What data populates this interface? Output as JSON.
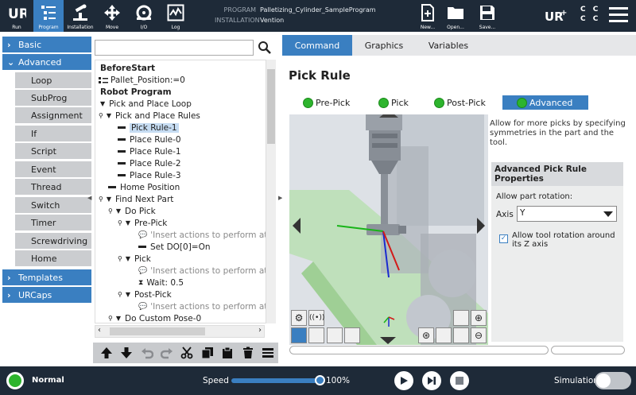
{
  "header": {
    "buttons": [
      {
        "label": "Run",
        "icon": "ur-logo-icon"
      },
      {
        "label": "Program",
        "icon": "program-icon"
      },
      {
        "label": "Installation",
        "icon": "installation-icon"
      },
      {
        "label": "Move",
        "icon": "move-icon"
      },
      {
        "label": "I/O",
        "icon": "io-icon"
      },
      {
        "label": "Log",
        "icon": "log-icon"
      }
    ],
    "program_key": "PROGRAM",
    "program_value": "Palletizing_Cylinder_SampleProgram",
    "installation_key": "INSTALLATION",
    "installation_value": "Vention",
    "file_buttons": [
      {
        "label": "New...",
        "icon": "new-file-icon"
      },
      {
        "label": "Open...",
        "icon": "open-folder-icon"
      },
      {
        "label": "Save...",
        "icon": "save-icon"
      }
    ],
    "cc_line1": "C C",
    "cc_line2": "C C"
  },
  "nav": {
    "groups": [
      {
        "label": "Basic"
      },
      {
        "label": "Advanced"
      },
      {
        "label": "Templates"
      },
      {
        "label": "URCaps"
      }
    ],
    "advanced_items": [
      "Loop",
      "SubProg",
      "Assignment",
      "If",
      "Script",
      "Event",
      "Thread",
      "Switch",
      "Timer",
      "Screwdriving",
      "Home"
    ]
  },
  "tree": {
    "rows": [
      "BeforeStart",
      "Pallet_Position:=0",
      "Robot Program",
      "Pick and Place Loop",
      "Pick and Place Rules",
      "Pick Rule-1",
      "Place Rule-0",
      "Place Rule-1",
      "Place Rule-2",
      "Place Rule-3",
      "Home Position",
      "Find Next Part",
      "Do Pick",
      "Pre-Pick",
      "'Insert actions to perform at p",
      "Set DO[0]=On",
      "Pick",
      "'Insert actions to perform at p",
      "Wait: 0.5",
      "Post-Pick",
      "'Insert actions to perform at p",
      "Do Custom Pose-0"
    ]
  },
  "tabs": [
    "Command",
    "Graphics",
    "Variables"
  ],
  "command": {
    "title": "Pick Rule",
    "steps": [
      "Pre-Pick",
      "Pick",
      "Post-Pick",
      "Advanced"
    ],
    "description": "Allow for more picks by specifying symmetries in the part and the tool.",
    "props_title": "Advanced Pick Rule Properties",
    "rotation_label": "Allow part rotation:",
    "axis_label": "Axis",
    "axis_value": "Y",
    "tool_rotation_label": "Allow tool rotation around its Z axis",
    "tool_rotation_checked": true
  },
  "footer": {
    "status": "Normal",
    "speed_label": "Speed",
    "speed_value": "100%",
    "speed_fraction": 1.0,
    "simulation_label": "Simulation"
  },
  "colors": {
    "accent": "#3a7fc1",
    "header_bg": "#1e2a38",
    "ok_green": "#2db42d"
  }
}
